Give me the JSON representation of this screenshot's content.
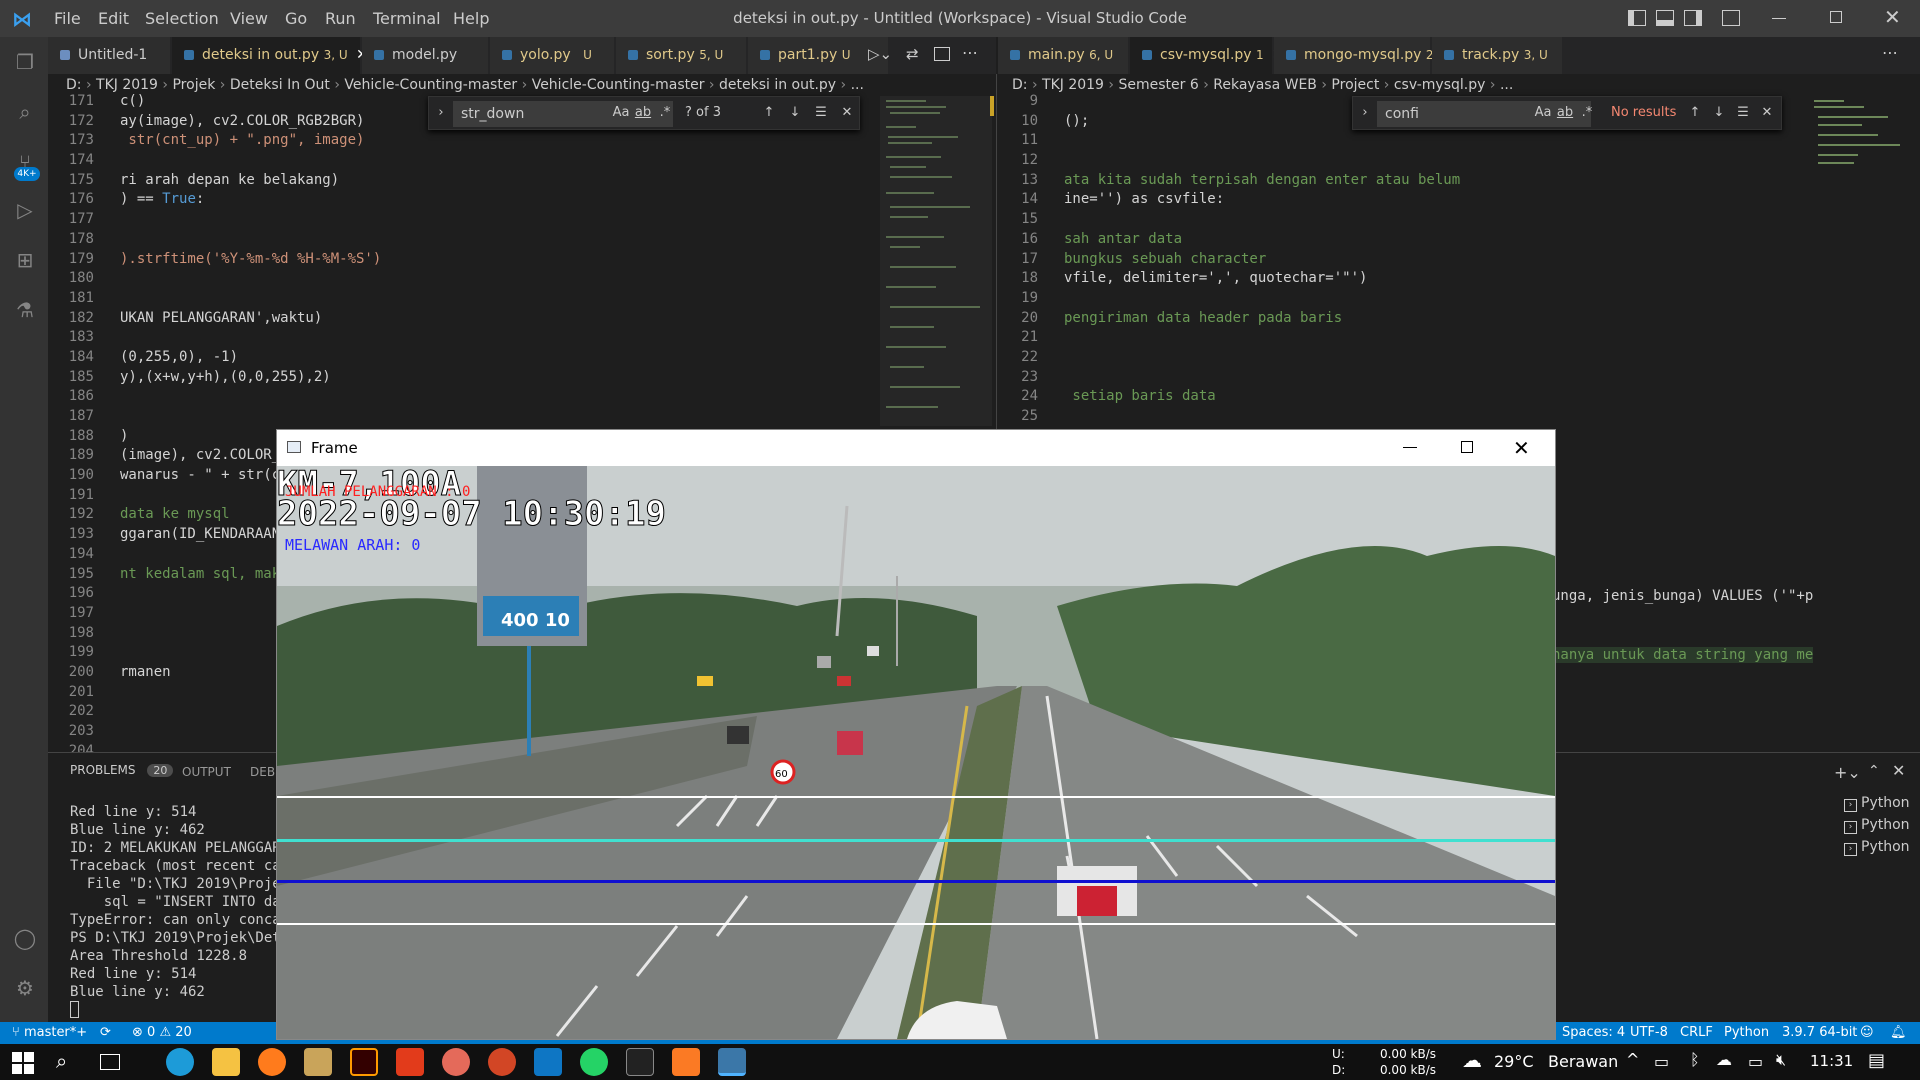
{
  "window": {
    "title": "deteksi in out.py - Untitled (Workspace) - Visual Studio Code",
    "menu": [
      "File",
      "Edit",
      "Selection",
      "View",
      "Go",
      "Run",
      "Terminal",
      "Help"
    ]
  },
  "left_tabs": [
    {
      "label": "Untitled-1",
      "suffix": ""
    },
    {
      "label": "deteksi in out.py",
      "suffix": "3, U"
    },
    {
      "label": "model.py",
      "suffix": ""
    },
    {
      "label": "yolo.py",
      "suffix": "U"
    },
    {
      "label": "sort.py",
      "suffix": "5, U"
    },
    {
      "label": "part1.py",
      "suffix": "U"
    }
  ],
  "right_tabs": [
    {
      "label": "main.py",
      "suffix": "6, U"
    },
    {
      "label": "csv-mysql.py",
      "suffix": "1"
    },
    {
      "label": "mongo-mysql.py",
      "suffix": "2"
    },
    {
      "label": "track.py",
      "suffix": "3, U"
    }
  ],
  "left_breadcrumb": [
    "D:",
    "TKJ 2019",
    "Projek",
    "Deteksi In Out",
    "Vehicle-Counting-master",
    "Vehicle-Counting-master",
    "deteksi in out.py",
    "..."
  ],
  "right_breadcrumb": [
    "D:",
    "TKJ 2019",
    "Semester 6",
    "Rekayasa WEB",
    "Project",
    "csv-mysql.py",
    "..."
  ],
  "left_find": {
    "query": "str_down",
    "result": "? of 3",
    "aa": "Aa",
    "ab": "ab",
    "re": ".*"
  },
  "right_find": {
    "query": "confi",
    "result": "No results",
    "aa": "Aa",
    "ab": "ab",
    "re": ".*"
  },
  "left_lines": [
    {
      "n": "171",
      "t": "c()"
    },
    {
      "n": "172",
      "t": "ay(image), cv2.COLOR_RGB2BGR)"
    },
    {
      "n": "173",
      "t": " str(cnt_up) + \".png\", image)"
    },
    {
      "n": "174",
      "t": ""
    },
    {
      "n": "175",
      "t": "ri arah depan ke belakang)"
    },
    {
      "n": "176",
      "t": ") == True:"
    },
    {
      "n": "177",
      "t": ""
    },
    {
      "n": "178",
      "t": ""
    },
    {
      "n": "179",
      "t": ").strftime('%Y-%m-%d %H-%M-%S')"
    },
    {
      "n": "180",
      "t": ""
    },
    {
      "n": "181",
      "t": ""
    },
    {
      "n": "182",
      "t": "UKAN PELANGGARAN',waktu)"
    },
    {
      "n": "183",
      "t": ""
    },
    {
      "n": "184",
      "t": "(0,255,0), -1)"
    },
    {
      "n": "185",
      "t": "y),(x+w,y+h),(0,0,255),2)"
    },
    {
      "n": "186",
      "t": ""
    },
    {
      "n": "187",
      "t": ""
    },
    {
      "n": "188",
      "t": ")"
    },
    {
      "n": "189",
      "t": "(image), cv2.COLOR_"
    },
    {
      "n": "190",
      "t": "wanarus - \" + str(c"
    },
    {
      "n": "191",
      "t": ""
    },
    {
      "n": "192",
      "t": "data ke mysql"
    },
    {
      "n": "193",
      "t": "ggaran(ID_KENDARAAN"
    },
    {
      "n": "194",
      "t": ""
    },
    {
      "n": "195",
      "t": "nt kedalam sql, maka"
    },
    {
      "n": "196",
      "t": ""
    },
    {
      "n": "197",
      "t": ""
    },
    {
      "n": "198",
      "t": ""
    },
    {
      "n": "199",
      "t": ""
    },
    {
      "n": "200",
      "t": "rmanen"
    },
    {
      "n": "201",
      "t": ""
    },
    {
      "n": "202",
      "t": ""
    },
    {
      "n": "203",
      "t": ""
    },
    {
      "n": "204",
      "t": ""
    }
  ],
  "right_lines": [
    {
      "n": "9",
      "t": ""
    },
    {
      "n": "10",
      "t": "();"
    },
    {
      "n": "11",
      "t": ""
    },
    {
      "n": "12",
      "t": ""
    },
    {
      "n": "13",
      "t": "ata kita sudah terpisah dengan enter atau belum"
    },
    {
      "n": "14",
      "t": "ine='') as csvfile:"
    },
    {
      "n": "15",
      "t": ""
    },
    {
      "n": "16",
      "t": "sah antar data"
    },
    {
      "n": "17",
      "t": "bungkus sebuah character"
    },
    {
      "n": "18",
      "t": "vfile, delimiter=',', quotechar='\"')"
    },
    {
      "n": "19",
      "t": ""
    },
    {
      "n": "20",
      "t": "pengiriman data header pada baris"
    },
    {
      "n": "21",
      "t": ""
    },
    {
      "n": "22",
      "t": ""
    },
    {
      "n": "23",
      "t": ""
    },
    {
      "n": "24",
      "t": " setiap baris data"
    },
    {
      "n": "25",
      "t": ""
    }
  ],
  "right_tail": {
    "line1": "unga, jenis_bunga) VALUES ('\"+p",
    "line2": "hanya untuk data string yang me"
  },
  "panel": {
    "tabs": [
      "PROBLEMS",
      "OUTPUT",
      "DEBU"
    ],
    "problems_count": "20",
    "terminal": [
      "Red line y: 514",
      "Blue line y: 462",
      "ID: 2 MELAKUKAN PELANGGARA",
      "Traceback (most recent cal",
      "  File \"D:\\TKJ 2019\\Projek",
      "    sql = \"INSERT INTO dat",
      "TypeError: can only concat",
      "PS D:\\TKJ 2019\\Projek\\Dete",
      "Area Threshold 1228.8",
      "Red line y: 514",
      "Blue line y: 462",
      ""
    ],
    "shells": [
      "Python",
      "Python",
      "Python"
    ]
  },
  "status": {
    "branch": "master*+",
    "errors": "0",
    "warnings": "20",
    "spaces": "Spaces: 4",
    "encoding": "UTF-8",
    "eol": "CRLF",
    "lang": "Python",
    "interp": "3.9.7 64-bit"
  },
  "frame": {
    "title": "Frame",
    "location": "KM-7,100A",
    "timestamp": "2022-09-07 10:30:19",
    "violations": "JUMLAH PELANGGARAN : 0",
    "wrong_way": "MELAWAN ARAH: 0",
    "billboard": "400 10",
    "speed_sign": "60"
  },
  "taskbar": {
    "net_up_label": "U:",
    "net_up": "0.00 kB/s",
    "net_down_label": "D:",
    "net_down": "0.00 kB/s",
    "temp": "29°C",
    "weather": "Berawan",
    "time": "11:31"
  },
  "colors": {
    "accent": "#007acc",
    "titlebar": "#3c3c3c",
    "editor_bg": "#1e1e1e"
  }
}
